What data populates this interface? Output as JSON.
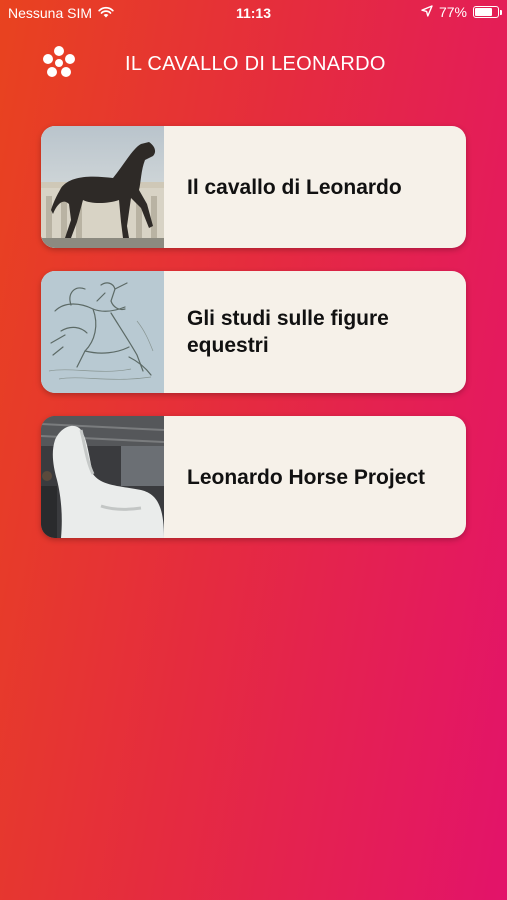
{
  "status_bar": {
    "carrier": "Nessuna SIM",
    "wifi_icon": "wifi-icon",
    "time": "11:13",
    "location_icon": "location-arrow-icon",
    "battery_percent": "77%",
    "battery_level": 0.77
  },
  "header": {
    "logo_icon": "dots-flower-logo-icon",
    "title": "IL CAVALLO DI LEONARDO"
  },
  "cards": [
    {
      "label": "Il cavallo di Leonardo",
      "thumbnail": "bronze-horse-statue-photo"
    },
    {
      "label": "Gli studi sulle figure equestri",
      "thumbnail": "equestrian-sketch-drawing"
    },
    {
      "label": "Leonardo Horse Project",
      "thumbnail": "white-horse-model-photo"
    }
  ],
  "colors": {
    "gradient_start": "#e8431f",
    "gradient_end": "#e3136a",
    "card_background": "#f6f1e9",
    "text_on_gradient": "#ffffff"
  }
}
